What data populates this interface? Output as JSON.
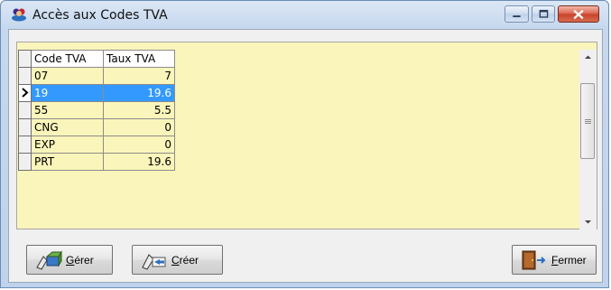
{
  "window": {
    "title": "Accès aux Codes TVA",
    "app_icon": "users-icon",
    "controls": [
      "minimize-icon",
      "maximize-icon",
      "close-icon"
    ]
  },
  "grid": {
    "columns": [
      "Code TVA",
      "Taux TVA"
    ],
    "rows": [
      {
        "code": "07",
        "rate": "7"
      },
      {
        "code": "19",
        "rate": "19.6"
      },
      {
        "code": "55",
        "rate": "5.5"
      },
      {
        "code": "CNG",
        "rate": "0"
      },
      {
        "code": "EXP",
        "rate": "0"
      },
      {
        "code": "PRT",
        "rate": "19.6"
      }
    ],
    "selected_row": "19",
    "background_color": "#faf5ba",
    "selection_color": "#3399ff"
  },
  "buttons": {
    "gerer": {
      "first": "G",
      "rest": "érer",
      "icon": "manage-icon"
    },
    "creer": {
      "first": "C",
      "rest": "réer",
      "icon": "create-icon"
    },
    "fermer": {
      "first": "F",
      "rest": "ermer",
      "icon": "exit-door-icon"
    }
  }
}
